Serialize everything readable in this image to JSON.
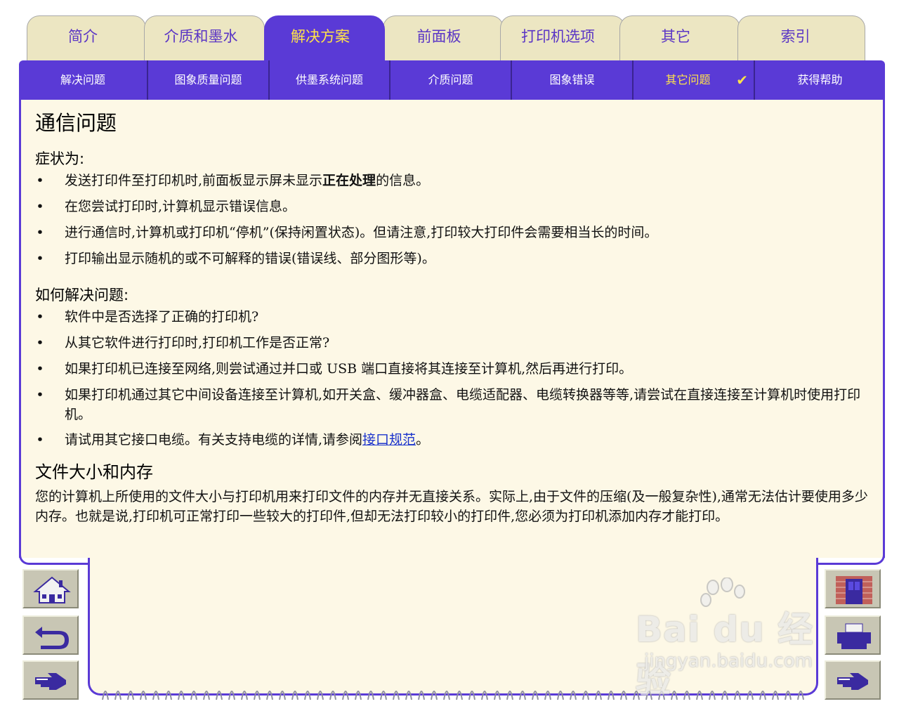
{
  "tabs": [
    {
      "label": "简介",
      "active": false
    },
    {
      "label": "介质和墨水",
      "active": false
    },
    {
      "label": "解决方案",
      "active": true
    },
    {
      "label": "前面板",
      "active": false
    },
    {
      "label": "打印机选项",
      "active": false
    },
    {
      "label": "其它",
      "active": false
    },
    {
      "label": "索引",
      "active": false
    }
  ],
  "subnav": [
    {
      "label": "解决问题"
    },
    {
      "label": "图象质量问题"
    },
    {
      "label": "供墨系统问题"
    },
    {
      "label": "介质问题"
    },
    {
      "label": "图象错误"
    },
    {
      "label": "其它问题",
      "active": true,
      "check": "✔"
    },
    {
      "label": "获得帮助"
    }
  ],
  "page": {
    "title": "通信问题",
    "symptoms_heading": "症状为:",
    "symptoms": [
      {
        "pre": "发送打印件至打印机时,前面板显示屏未显示",
        "bold": "正在处理",
        "post": "的信息。"
      },
      {
        "text": "在您尝试打印时,计算机显示错误信息。"
      },
      {
        "text": "进行通信时,计算机或打印机“停机”(保持闲置状态)。但请注意,打印较大打印件会需要相当长的时间。"
      },
      {
        "text": "打印输出显示随机的或不可解释的错误(错误线、部分图形等)。"
      }
    ],
    "solutions_heading": "如何解决问题:",
    "solutions": [
      {
        "text": "软件中是否选择了正确的打印机?"
      },
      {
        "text": "从其它软件进行打印时,打印机工作是否正常?"
      },
      {
        "text": "如果打印机已连接至网络,则尝试通过并口或 USB 端口直接将其连接至计算机,然后再进行打印。"
      },
      {
        "text": "如果打印机通过其它中间设备连接至计算机,如开关盒、缓冲器盒、电缆适配器、电缆转换器等等,请尝试在直接连接至计算机时使用打印机。"
      },
      {
        "pre": "请试用其它接口电缆。有关支持电缆的详情,请参阅",
        "link": "接口规范",
        "post": "。"
      }
    ],
    "section2_heading": "文件大小和内存",
    "section2_text": "您的计算机上所使用的文件大小与打印机用来打印文件的内存并无直接关系。实际上,由于文件的压缩(及一般复杂性),通常无法估计要使用多少内存。也就是说,打印机可正常打印一些较大的打印件,但却无法打印较小的打印件,您必须为打印机添加内存才能打印。"
  },
  "bullet": "•",
  "side_buttons": {
    "left": [
      "home-icon",
      "back-icon",
      "next-page-icon"
    ],
    "right": [
      "exit-door-icon",
      "printer-icon",
      "next-page-icon"
    ]
  },
  "watermark": {
    "brand": "Bai du 经验",
    "url": "jingyan.baidu.com"
  },
  "colors": {
    "accent": "#5a3ad6",
    "panel": "#fdf8e6",
    "tab": "#ece6c2",
    "active_text": "#ffe34a",
    "link": "#1a33cc"
  }
}
